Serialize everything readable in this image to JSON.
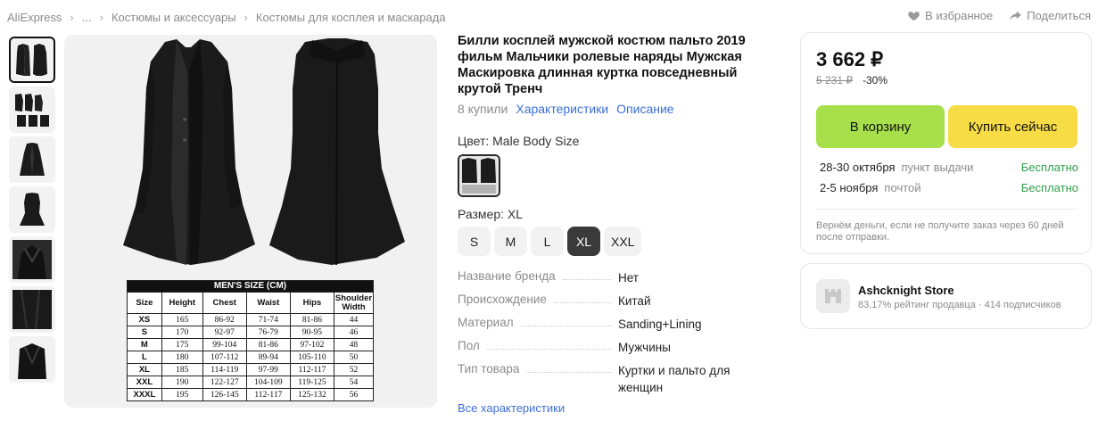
{
  "breadcrumb": {
    "items": [
      "AliExpress",
      "...",
      "Костюмы и аксессуары",
      "Костюмы для косплея и маскарада"
    ]
  },
  "top_actions": {
    "favorite_label": "В избранное",
    "share_label": "Поделиться"
  },
  "gallery": {
    "thumb_count": 7,
    "active_index": 0,
    "size_chart": {
      "title": "MEN'S SIZE (CM)",
      "headers": [
        "Size",
        "Height",
        "Chest",
        "Waist",
        "Hips",
        "Shoulder Width"
      ],
      "rows": [
        [
          "XS",
          "165",
          "86-92",
          "71-74",
          "81-86",
          "44"
        ],
        [
          "S",
          "170",
          "92-97",
          "76-79",
          "90-95",
          "46"
        ],
        [
          "M",
          "175",
          "99-104",
          "81-86",
          "97-102",
          "48"
        ],
        [
          "L",
          "180",
          "107-112",
          "89-94",
          "105-110",
          "50"
        ],
        [
          "XL",
          "185",
          "114-119",
          "97-99",
          "112-117",
          "52"
        ],
        [
          "XXL",
          "190",
          "122-127",
          "104-109",
          "119-125",
          "54"
        ],
        [
          "XXXL",
          "195",
          "126-145",
          "112-117",
          "125-132",
          "56"
        ]
      ]
    }
  },
  "product": {
    "title": "Билли косплей мужской костюм пальто 2019 фильм Мальчики ролевые наряды Мужская Маскировка длинная куртка повседневный крутой Тренч",
    "bought": "8 купили",
    "characteristics_link": "Характеристики",
    "description_link": "Описание",
    "color_label": "Цвет: Male Body Size",
    "size_label": "Размер: XL",
    "sizes": [
      "S",
      "M",
      "L",
      "XL",
      "XXL"
    ],
    "selected_size": "XL",
    "specs": [
      {
        "key": "Название бренда",
        "value": "Нет"
      },
      {
        "key": "Происхождение",
        "value": "Китай"
      },
      {
        "key": "Материал",
        "value": "Sanding+Lining"
      },
      {
        "key": "Пол",
        "value": "Мужчины"
      },
      {
        "key": "Тип товара",
        "value": "Куртки и пальто для женщин"
      }
    ],
    "all_specs_link": "Все характеристики"
  },
  "buybox": {
    "price": "3 662 ₽",
    "old_price": "5 231 ₽",
    "discount": "-30%",
    "cart_button": "В корзину",
    "buy_button": "Купить сейчас",
    "delivery": [
      {
        "date": "28-30 октября",
        "method": "пункт выдачи",
        "price": "Бесплатно"
      },
      {
        "date": "2-5 ноября",
        "method": "почтой",
        "price": "Бесплатно"
      }
    ],
    "refund_note": "Вернём деньги, если не получите заказ через 60 дней после отправки."
  },
  "store": {
    "name": "Ashcknight Store",
    "rating": "83,17% рейтинг продавца",
    "subscribers": "414 подписчиков"
  },
  "colors": {
    "link": "#3b6fd8",
    "cart_button": "#a7e04a",
    "buy_button": "#f7dc45",
    "free_delivery": "#2fa04a"
  }
}
